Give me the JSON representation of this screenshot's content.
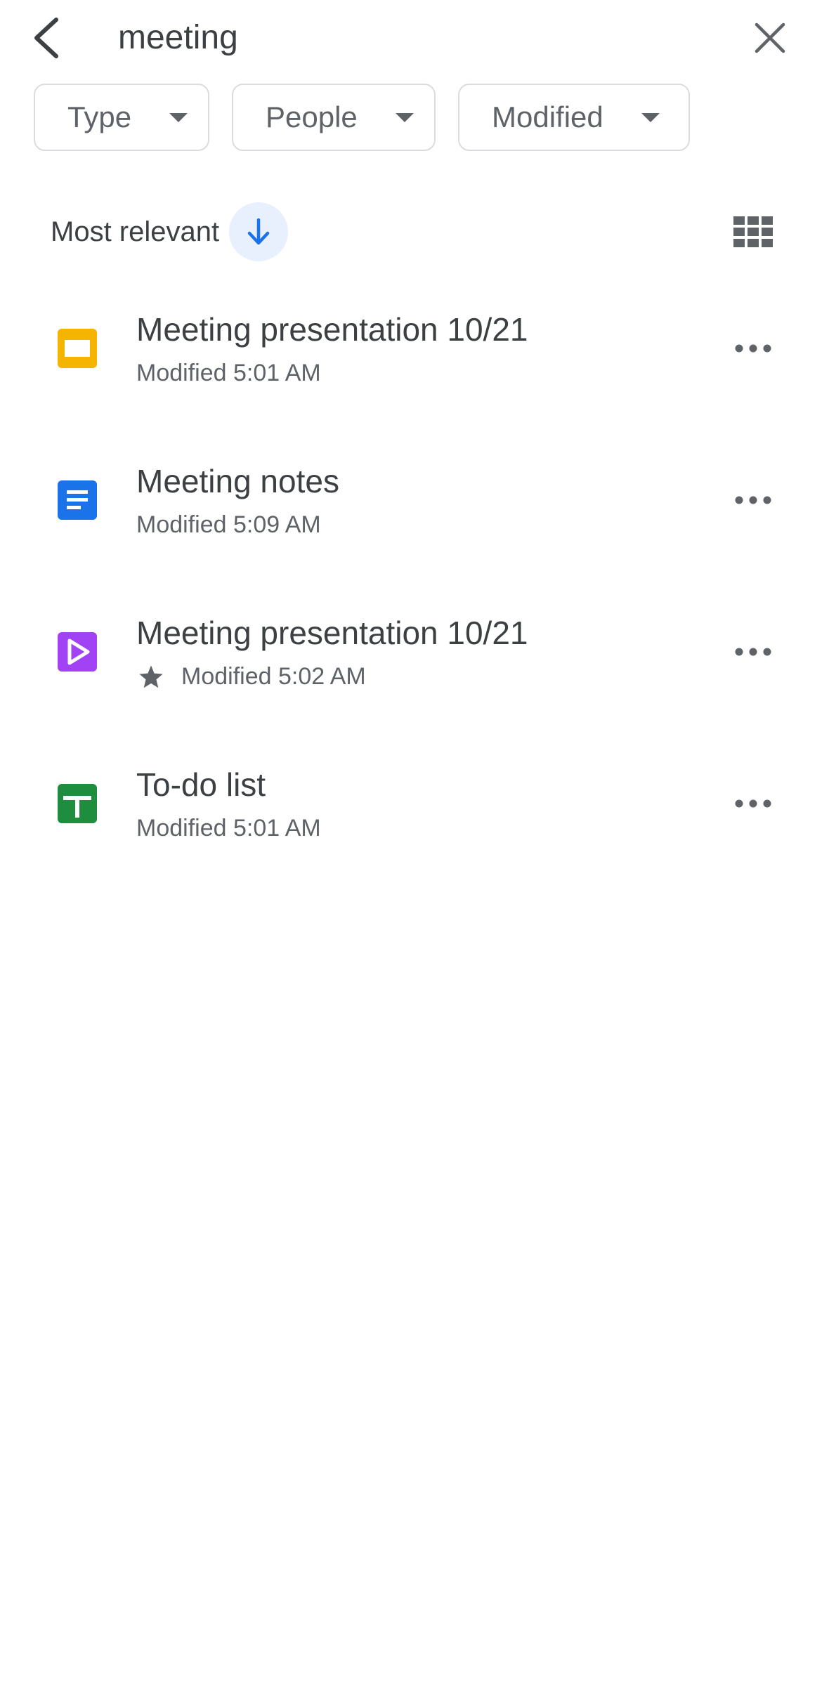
{
  "search": {
    "query": "meeting"
  },
  "filters": [
    {
      "label": "Type"
    },
    {
      "label": "People"
    },
    {
      "label": "Modified"
    }
  ],
  "sort": {
    "label": "Most relevant",
    "direction_icon": "arrow-down-icon"
  },
  "view_toggle_icon": "grid-view-icon",
  "files": [
    {
      "title": "Meeting presentation 10/21",
      "modified": "Modified 5:01 AM",
      "type": "slides",
      "starred": false,
      "icon_color": "#f4b400"
    },
    {
      "title": "Meeting notes",
      "modified": "Modified 5:09 AM",
      "type": "docs",
      "starred": false,
      "icon_color": "#1a73e8"
    },
    {
      "title": "Meeting presentation 10/21",
      "modified": "Modified 5:02 AM",
      "type": "vids",
      "starred": true,
      "icon_color": "#a142f4"
    },
    {
      "title": "To-do list",
      "modified": "Modified 5:01 AM",
      "type": "sheets",
      "starred": false,
      "icon_color": "#1e8e3e"
    }
  ],
  "colors": {
    "accent": "#1a73e8",
    "sort_button_bg": "#e8f0fe",
    "text_primary": "#3c4043",
    "text_secondary": "#5f6368",
    "chip_border": "#dadce0"
  }
}
